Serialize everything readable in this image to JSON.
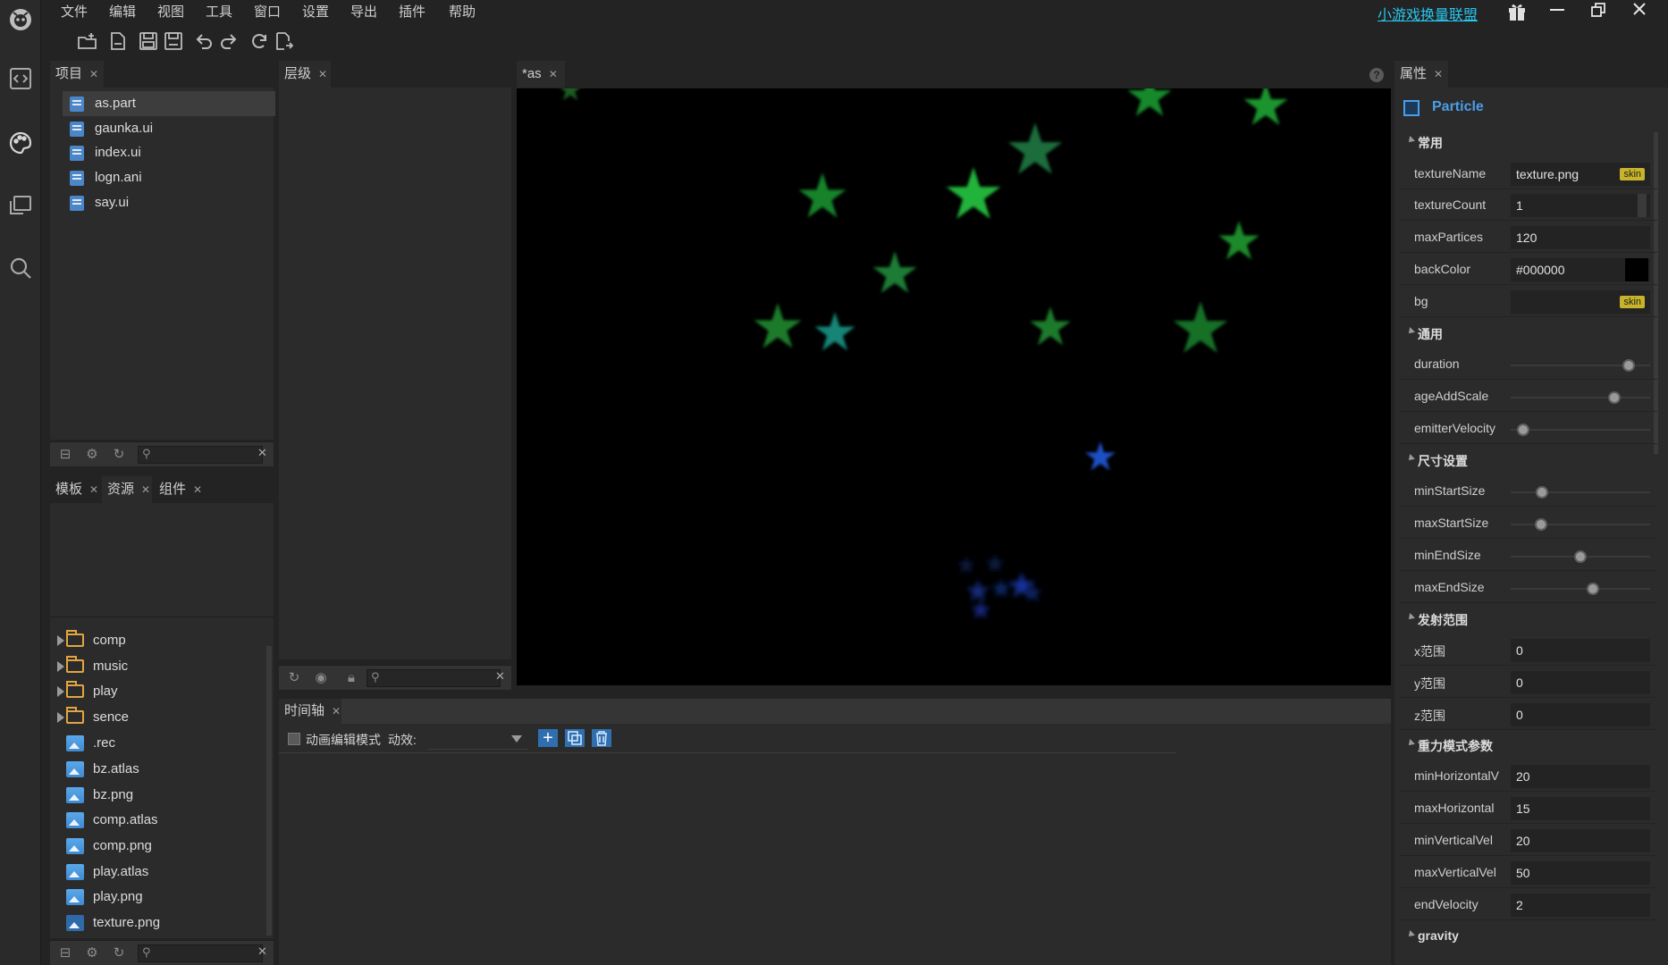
{
  "menu": [
    "文件",
    "编辑",
    "视图",
    "工具",
    "窗口",
    "设置",
    "导出",
    "插件",
    "帮助"
  ],
  "title_link": "小游戏换量联盟",
  "project_panel": {
    "tab": "项目",
    "files": [
      "as.part",
      "gaunka.ui",
      "index.ui",
      "logn.ani",
      "say.ui"
    ]
  },
  "asset_tabs": [
    "模板",
    "资源",
    "组件"
  ],
  "resources": {
    "folders": [
      "comp",
      "music",
      "play",
      "sence"
    ],
    "files": [
      ".rec",
      "bz.atlas",
      "bz.png",
      "comp.atlas",
      "comp.png",
      "play.atlas",
      "play.png",
      "texture.png"
    ]
  },
  "layer_tab": "层级",
  "editor_tab": "*as",
  "timeline": {
    "tab": "时间轴",
    "mode_label": "动画编辑模式",
    "effect_label": "动效:"
  },
  "props": {
    "tab": "属性",
    "component": "Particle",
    "sections": {
      "common": "常用",
      "general": "通用",
      "size": "尺寸设置",
      "emit": "发射范围",
      "gravity_params": "重力模式参数",
      "gravity": "gravity"
    },
    "common": [
      {
        "label": "textureName",
        "value": "texture.png",
        "badge": "skin"
      },
      {
        "label": "textureCount",
        "value": "1"
      },
      {
        "label": "maxPartices",
        "value": "120"
      },
      {
        "label": "backColor",
        "value": "#000000"
      },
      {
        "label": "bg",
        "value": "",
        "badge": "skin"
      }
    ],
    "general": [
      {
        "label": "duration",
        "level": 0.88
      },
      {
        "label": "ageAddScale",
        "level": 0.77
      },
      {
        "label": "emitterVelocity",
        "level": 0.05
      }
    ],
    "size": [
      {
        "label": "minStartSize",
        "level": 0.2
      },
      {
        "label": "maxStartSize",
        "level": 0.19
      },
      {
        "label": "minEndSize",
        "level": 0.5
      },
      {
        "label": "maxEndSize",
        "level": 0.6
      }
    ],
    "emit": [
      {
        "label": "x范围",
        "value": "0"
      },
      {
        "label": "y范围",
        "value": "0"
      },
      {
        "label": "z范围",
        "value": "0"
      }
    ],
    "gravity_params": [
      {
        "label": "minHorizontalV",
        "value": "20"
      },
      {
        "label": "maxHorizontal",
        "value": "15"
      },
      {
        "label": "minVerticalVel",
        "value": "20"
      },
      {
        "label": "maxVerticalVel",
        "value": "50"
      },
      {
        "label": "endVelocity",
        "value": "2"
      }
    ]
  },
  "colors": {
    "accent": "#4a9ee8",
    "link": "#27c6ee",
    "star_green": "#1b8a2c",
    "star_teal": "#128476",
    "star_blue": "#1f4fc4"
  }
}
